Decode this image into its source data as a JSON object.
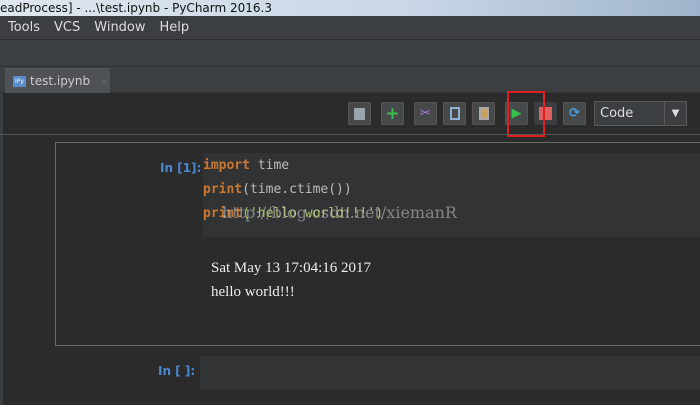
{
  "window": {
    "title": "eadProcess] - ...\\test.ipynb - PyCharm 2016.3"
  },
  "menu": [
    "Tools",
    "VCS",
    "Window",
    "Help"
  ],
  "tab": {
    "label": "test.ipynb",
    "icon": "IPy",
    "close": "×"
  },
  "toolbar": {
    "save": "save-icon",
    "add": "+",
    "cut": "cut-icon",
    "copy": "copy-icon",
    "paste": "paste-icon",
    "run": "▶",
    "stop": "■",
    "restart": "⟳",
    "cell_type": "Code",
    "dropdown": "▼"
  },
  "cells": [
    {
      "prompt": "In [1]:",
      "code": [
        [
          "import",
          " time"
        ],
        [
          "print",
          "(time.ctime())"
        ],
        [
          "print",
          "('hello world!!!')"
        ]
      ],
      "output": [
        "Sat May 13 17:04:16 2017",
        "hello world!!!"
      ]
    },
    {
      "prompt": "In [ ]:"
    }
  ],
  "watermark": "http://blog.csdn.net/xiemanR",
  "colors": {
    "accent_red": "#e02020",
    "keyword": "#cc7832",
    "prompt": "#4b86d0"
  }
}
